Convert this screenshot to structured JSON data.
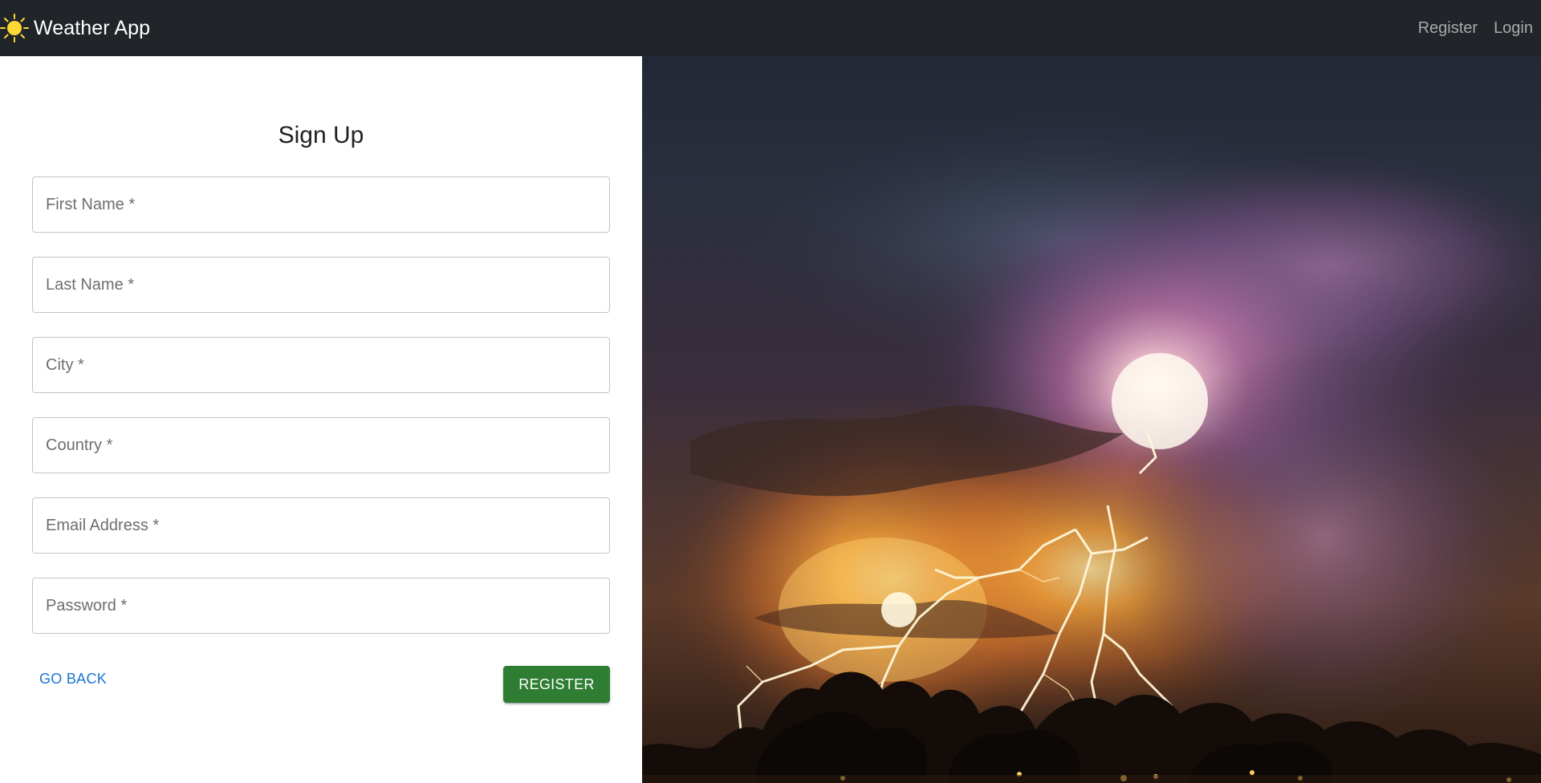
{
  "navbar": {
    "brand_title": "Weather App",
    "brand_icon": "sun-icon",
    "links": {
      "register": "Register",
      "login": "Login"
    }
  },
  "form": {
    "title": "Sign Up",
    "fields": {
      "first_name": "First Name *",
      "last_name": "Last Name *",
      "city": "City *",
      "country": "Country *",
      "email": "Email Address *",
      "password": "Password *"
    },
    "go_back_label": "GO BACK",
    "register_label": "REGISTER"
  },
  "hero_image": {
    "subject": "lightning storm over trees at night"
  },
  "colors": {
    "navbar_bg": "#212529",
    "register_button": "#2e7d32",
    "link_blue": "#1976d2",
    "sun_yellow": "#fdd835"
  }
}
